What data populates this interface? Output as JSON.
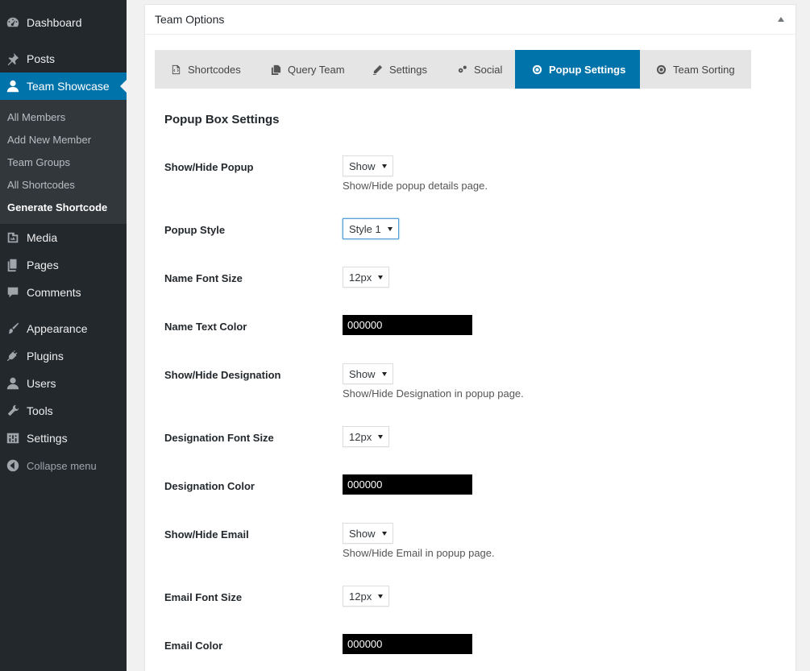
{
  "sidebar": {
    "items": [
      {
        "label": "Dashboard",
        "icon": "dashboard-icon"
      },
      {
        "label": "Posts",
        "icon": "pin-icon"
      },
      {
        "label": "Team Showcase",
        "icon": "user-icon"
      },
      {
        "label": "Media",
        "icon": "media-icon"
      },
      {
        "label": "Pages",
        "icon": "pages-icon"
      },
      {
        "label": "Comments",
        "icon": "comment-icon"
      },
      {
        "label": "Appearance",
        "icon": "brush-icon"
      },
      {
        "label": "Plugins",
        "icon": "plug-icon"
      },
      {
        "label": "Users",
        "icon": "users-icon"
      },
      {
        "label": "Tools",
        "icon": "wrench-icon"
      },
      {
        "label": "Settings",
        "icon": "settings-icon"
      },
      {
        "label": "Collapse menu",
        "icon": "collapse-icon"
      }
    ],
    "submenu": [
      "All Members",
      "Add New Member",
      "Team Groups",
      "All Shortcodes",
      "Generate Shortcode"
    ]
  },
  "panel": {
    "title": "Team Options"
  },
  "tabs": [
    {
      "label": "Shortcodes",
      "icon": "shortcode-icon"
    },
    {
      "label": "Query Team",
      "icon": "copy-icon"
    },
    {
      "label": "Settings",
      "icon": "pencil-icon"
    },
    {
      "label": "Social",
      "icon": "gears-icon"
    },
    {
      "label": "Popup Settings",
      "icon": "lifebuoy-icon"
    },
    {
      "label": "Team Sorting",
      "icon": "lifebuoy-icon"
    }
  ],
  "section_title": "Popup Box Settings",
  "fields": {
    "show_hide_popup": {
      "label": "Show/Hide Popup",
      "value": "Show",
      "desc": "Show/Hide popup details page."
    },
    "popup_style": {
      "label": "Popup Style",
      "value": "Style 1"
    },
    "name_font_size": {
      "label": "Name Font Size",
      "value": "12px"
    },
    "name_text_color": {
      "label": "Name Text Color",
      "value": "000000"
    },
    "show_hide_designation": {
      "label": "Show/Hide Designation",
      "value": "Show",
      "desc": "Show/Hide Designation in popup page."
    },
    "designation_font_size": {
      "label": "Designation Font Size",
      "value": "12px"
    },
    "designation_color": {
      "label": "Designation Color",
      "value": "000000"
    },
    "show_hide_email": {
      "label": "Show/Hide Email",
      "value": "Show",
      "desc": "Show/Hide Email in popup page."
    },
    "email_font_size": {
      "label": "Email Font Size",
      "value": "12px"
    },
    "email_color": {
      "label": "Email Color",
      "value": "000000"
    }
  },
  "colors": {
    "sidebar_bg": "#23282d",
    "submenu_bg": "#32373c",
    "accent": "#0073aa"
  }
}
